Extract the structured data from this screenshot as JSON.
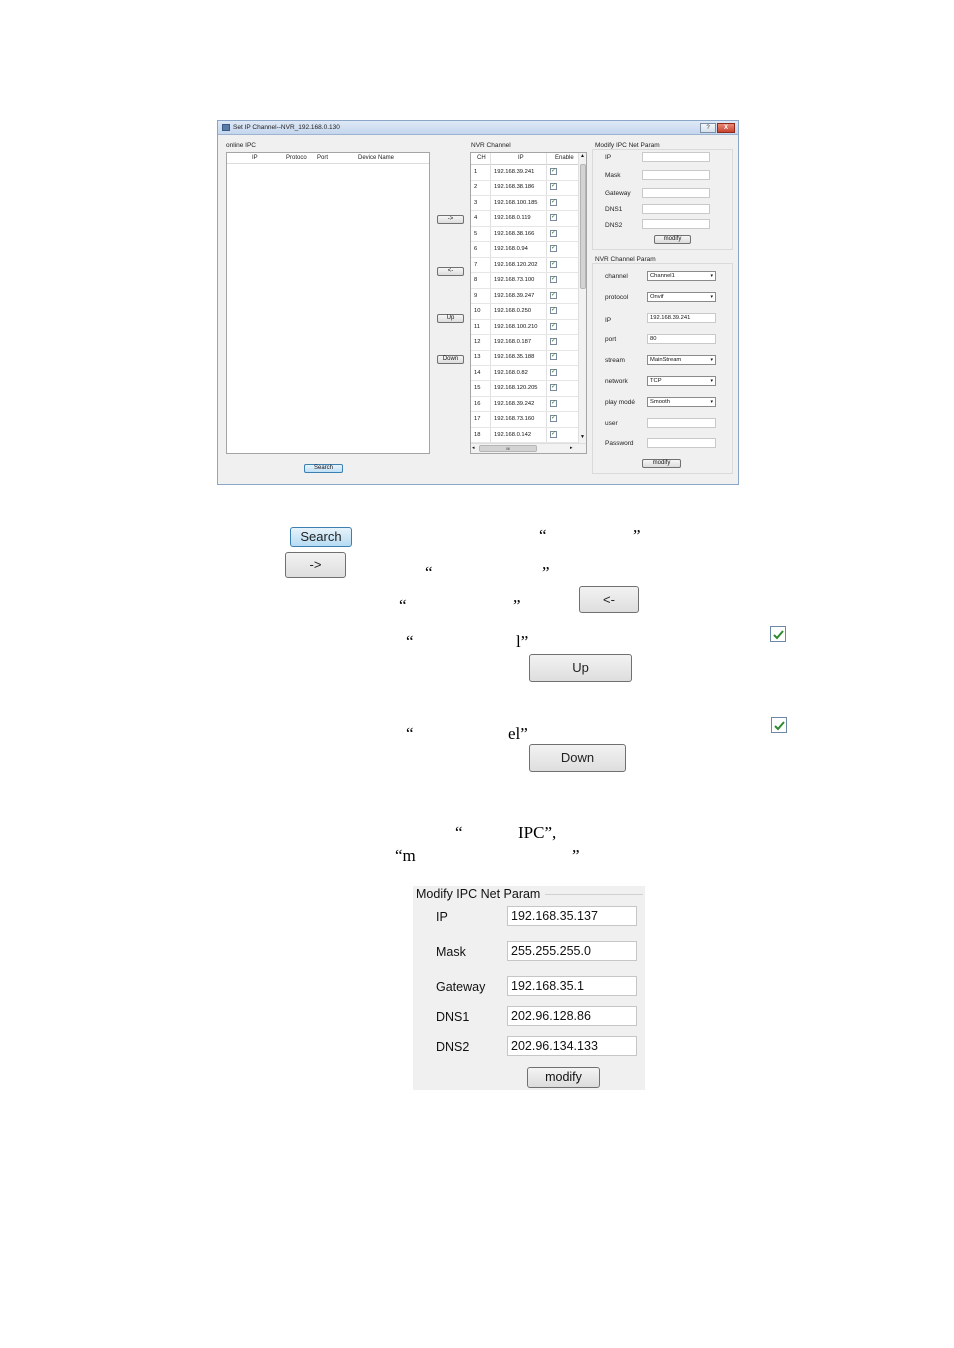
{
  "window": {
    "title": "Set IP Channel--NVR_192.168.0.130",
    "help_label": "?",
    "close_label": "X"
  },
  "online_ipc": {
    "label": "online IPC",
    "columns": [
      "IP",
      "Protoco",
      "Port",
      "Device Name"
    ],
    "search_label": "Search"
  },
  "transfer": {
    "add_label": "->",
    "remove_label": "<-",
    "up_label": "Up",
    "down_label": "Down"
  },
  "nvr_channel": {
    "label": "NVR Channel",
    "columns": [
      "CH",
      "IP",
      "Enable"
    ],
    "rows": [
      {
        "ch": "1",
        "ip": "192.168.39.241"
      },
      {
        "ch": "2",
        "ip": "192.168.38.186"
      },
      {
        "ch": "3",
        "ip": "192.168.100.185"
      },
      {
        "ch": "4",
        "ip": "192.168.0.119"
      },
      {
        "ch": "5",
        "ip": "192.168.38.166"
      },
      {
        "ch": "6",
        "ip": "192.168.0.94"
      },
      {
        "ch": "7",
        "ip": "192.168.120.202"
      },
      {
        "ch": "8",
        "ip": "192.168.73.100"
      },
      {
        "ch": "9",
        "ip": "192.168.39.247"
      },
      {
        "ch": "10",
        "ip": "192.168.0.250"
      },
      {
        "ch": "11",
        "ip": "192.168.100.210"
      },
      {
        "ch": "12",
        "ip": "192.168.0.187"
      },
      {
        "ch": "13",
        "ip": "192.168.35.188"
      },
      {
        "ch": "14",
        "ip": "192.168.0.82"
      },
      {
        "ch": "15",
        "ip": "192.168.120.205"
      },
      {
        "ch": "16",
        "ip": "192.168.39.242"
      },
      {
        "ch": "17",
        "ip": "192.168.73.160"
      },
      {
        "ch": "18",
        "ip": "192.168.0.142"
      }
    ],
    "check_mark": "✓",
    "scroll_up": "▲",
    "scroll_down": "▼",
    "scroll_left": "◂",
    "scroll_right": "▸",
    "scroll_grip": "III"
  },
  "modify_ipc_small": {
    "label": "Modify IPC Net Param",
    "fields": [
      "IP",
      "Mask",
      "Gateway",
      "DNS1",
      "DNS2"
    ],
    "modify_label": "modify"
  },
  "nvr_param": {
    "label": "NVR Channel Param",
    "channel_label": "channel",
    "channel_value": "Channel1",
    "protocol_label": "protocol",
    "protocol_value": "Onvif",
    "ip_label": "IP",
    "ip_value": "192.168.39.241",
    "port_label": "port",
    "port_value": "80",
    "stream_label": "stream",
    "stream_value": "MainStream",
    "network_label": "network",
    "network_value": "TCP",
    "playmode_label": "play modé",
    "playmode_value": "Smooth",
    "user_label": "user",
    "password_label": "Password",
    "modify_label": "modify",
    "arrow": "▾"
  },
  "doc": {
    "q1_open": "“",
    "q1_close": "”",
    "q2_open": "“",
    "q2_close": "”",
    "q3_open": "“",
    "q3_close": "”",
    "q4_open": "“",
    "q4_close": "l”",
    "q5_open": "“",
    "q5_close": "el”",
    "q6_open": "“",
    "q6_close": "IPC”,",
    "q7_open": "“m",
    "q7_close": "”",
    "search_btn": "Search",
    "add_btn": "->",
    "remove_btn": "<-",
    "up_btn": "Up",
    "down_btn": "Down"
  },
  "modify_panel": {
    "title": "Modify IPC Net Param",
    "fields": [
      {
        "label": "IP",
        "value": "192.168.35.137"
      },
      {
        "label": "Mask",
        "value": "255.255.255.0"
      },
      {
        "label": "Gateway",
        "value": "192.168.35.1"
      },
      {
        "label": "DNS1",
        "value": "202.96.128.86"
      },
      {
        "label": "DNS2",
        "value": "202.96.134.133"
      }
    ],
    "modify_label": "modify"
  }
}
